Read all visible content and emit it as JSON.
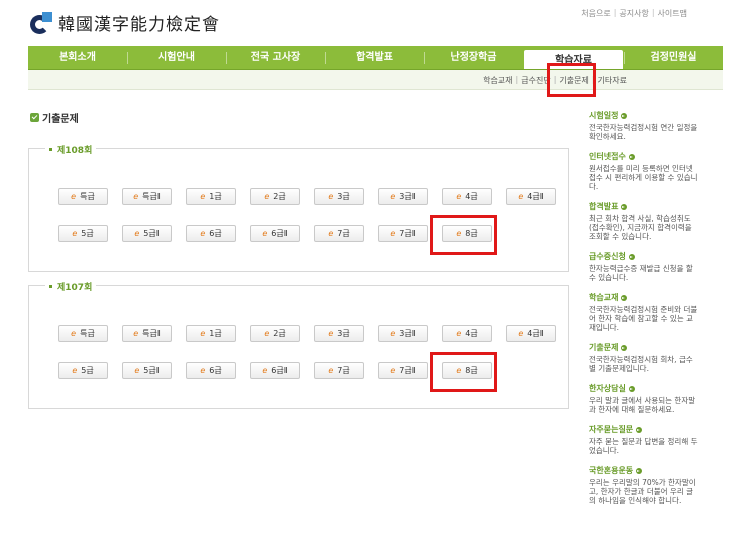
{
  "header": {
    "site_name": "韓國漢字能力檢定會",
    "util_links": [
      "처음으로",
      "공지사항",
      "사이트맵"
    ]
  },
  "nav": {
    "items": [
      "본회소개",
      "시험안내",
      "전국 고사장",
      "합격발표",
      "난정장학금",
      "학습자료",
      "검정민원실"
    ],
    "active_index": 5
  },
  "subnav": {
    "items": [
      "학습교재",
      "급수진단",
      "기출문제",
      "기타자료"
    ],
    "active": "기출문제"
  },
  "main": {
    "title": "기출문제",
    "rounds": [
      {
        "label": "제108회",
        "row1": [
          "특급",
          "특급Ⅱ",
          "1급",
          "2급",
          "3급",
          "3급Ⅱ",
          "4급",
          "4급Ⅱ"
        ],
        "row2": [
          "5급",
          "5급Ⅱ",
          "6급",
          "6급Ⅱ",
          "7급",
          "7급Ⅱ",
          "8급"
        ]
      },
      {
        "label": "제107회",
        "row1": [
          "특급",
          "특급Ⅱ",
          "1급",
          "2급",
          "3급",
          "3급Ⅱ",
          "4급",
          "4급Ⅱ"
        ],
        "row2": [
          "5급",
          "5급Ⅱ",
          "6급",
          "6급Ⅱ",
          "7급",
          "7급Ⅱ",
          "8급"
        ]
      }
    ]
  },
  "sidebar": {
    "items": [
      {
        "title": "시험일정",
        "desc": "전국한자능력검정시험 연간 일정을 확인하세요."
      },
      {
        "title": "인터넷접수",
        "desc": "원서접수를 미리 등록하면 인터넷접수 시 편리하게 이용할 수 있습니다."
      },
      {
        "title": "합격발표",
        "desc": "최근 회차 합격 사실, 학습성취도(접수확인), 지금까지 합격이력을 조회할 수 있습니다."
      },
      {
        "title": "급수증신청",
        "desc": "한자능력급수증 재발급 신청을 할 수 있습니다."
      },
      {
        "title": "학습교재",
        "desc": "전국한자능력검정시험 준비와 더불어 한자 학습에 참고할 수 있는 교재입니다."
      },
      {
        "title": "기출문제",
        "desc": "전국한자능력검정시험 회차, 급수별 기출문제입니다."
      },
      {
        "title": "한자상담실",
        "desc": "우리 말과 글에서 사용되는 한자말과 한자에 대해 질문하세요."
      },
      {
        "title": "자주묻는질문",
        "desc": "자주 묻는 질문과 답변을 정리해 두었습니다."
      },
      {
        "title": "국한혼용운동",
        "desc": "우리는 우리말의 70%가 한자말이고, 한자가 한글과 더불어 우리 글의 하나임을 인식해야 합니다."
      }
    ]
  },
  "colors": {
    "nav_green": "#8cbc3a",
    "highlight_red": "#e01818",
    "accent_green": "#6a9c2a"
  }
}
